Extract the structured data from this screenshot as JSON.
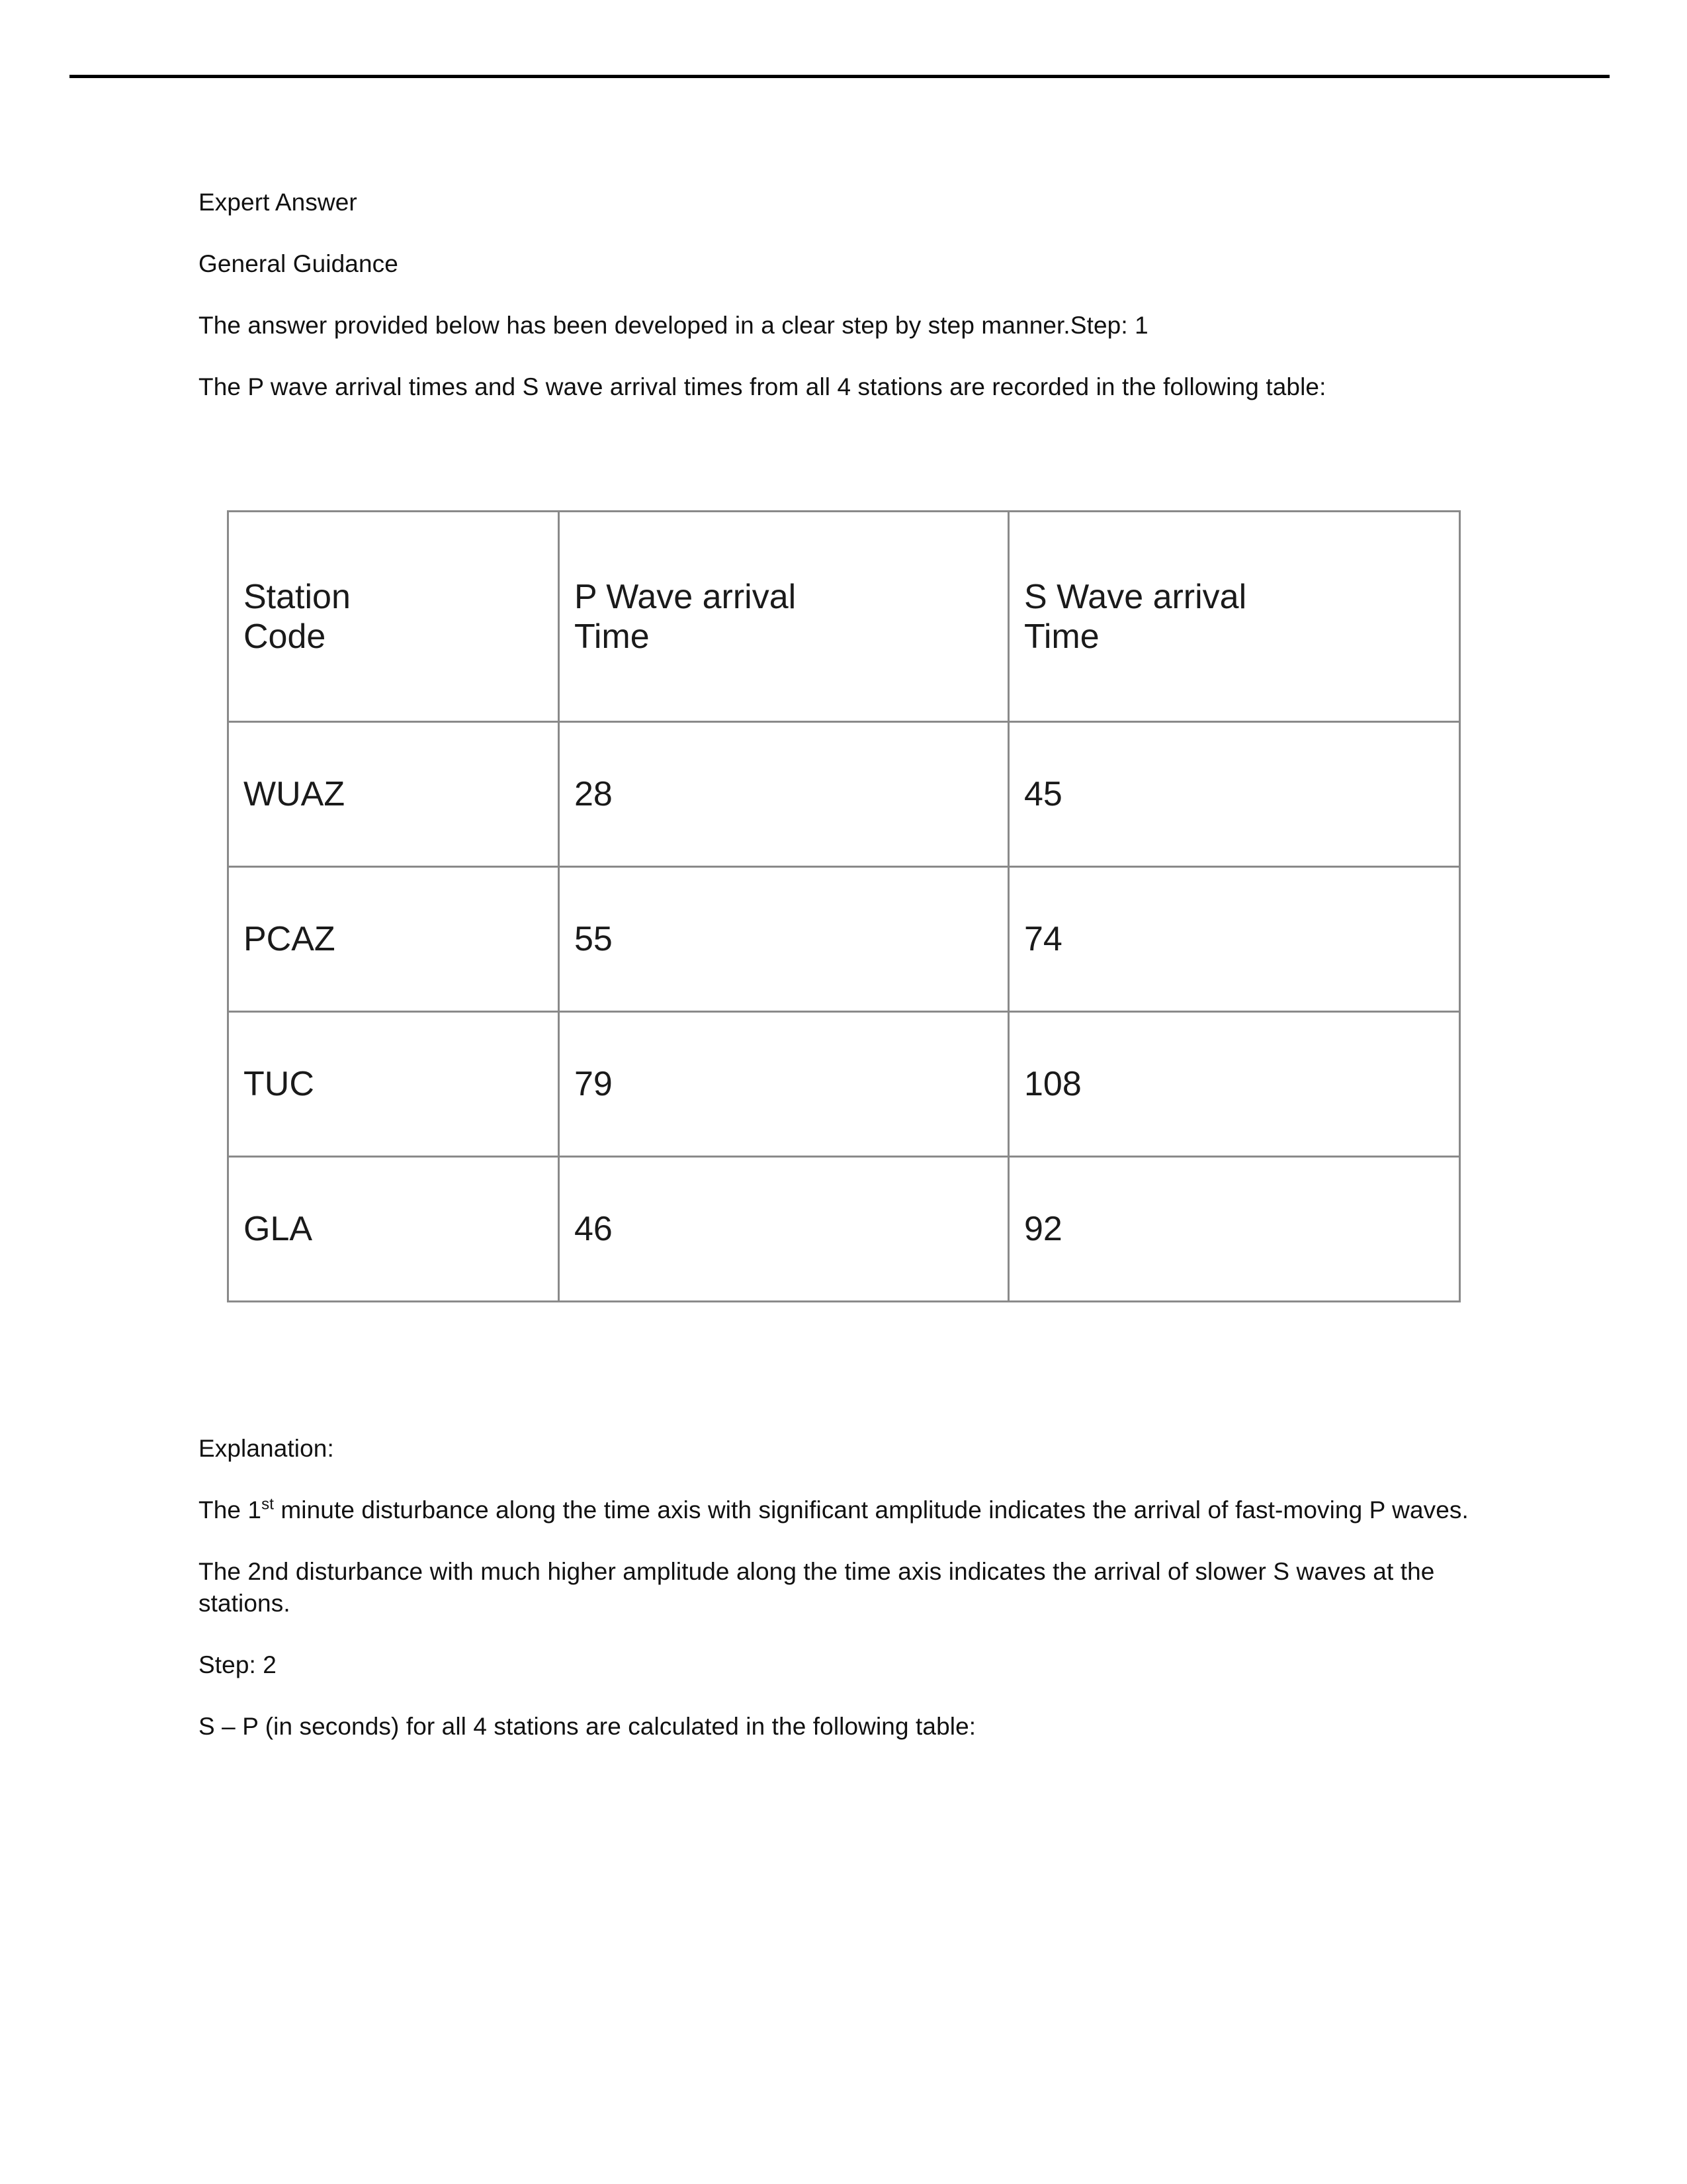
{
  "document": {
    "heading_1": "Expert Answer",
    "heading_2": "General Guidance",
    "para_intro": "The answer provided below has been developed in a clear step by step manner.Step: 1",
    "para_table_lead": "The P wave arrival times and S wave arrival times from all 4 stations are recorded in the following table:",
    "explanation_label": "Explanation:",
    "explanation_p1_before_sup": "The 1",
    "explanation_p1_sup": "st",
    "explanation_p1_after_sup": " minute disturbance along the time axis with significant amplitude indicates the arrival of fast-moving P waves.",
    "explanation_p2": "The 2nd disturbance with much higher amplitude along the time axis indicates the arrival of slower S waves at the stations.",
    "step_2_label": "Step: 2",
    "para_sp_lead": "S – P (in seconds) for all 4 stations are calculated in the following table:"
  },
  "table": {
    "headers": {
      "col1_line1": "Station",
      "col1_line2": "Code",
      "col2_line1": "P Wave arrival",
      "col2_line2": "Time",
      "col3_line1": "S Wave arrival",
      "col3_line2": "Time"
    },
    "rows": [
      {
        "station": "WUAZ",
        "p_wave": "28",
        "s_wave": "45"
      },
      {
        "station": "PCAZ",
        "p_wave": "55",
        "s_wave": "74"
      },
      {
        "station": "TUC",
        "p_wave": "79",
        "s_wave": "108"
      },
      {
        "station": "GLA",
        "p_wave": "46",
        "s_wave": "92"
      }
    ]
  },
  "style": {
    "table_border_color": "#8a8a8a",
    "rule_color": "#000000",
    "text_color": "#111111",
    "page_background": "#ffffff"
  }
}
